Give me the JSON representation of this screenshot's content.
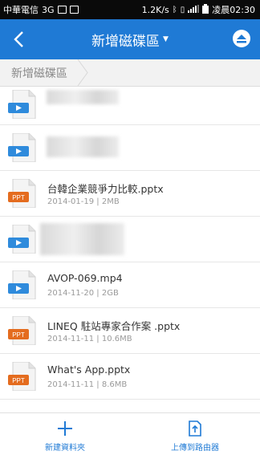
{
  "status_bar": {
    "carrier": "中華電信",
    "network": "3G",
    "speed": "1.2K/s",
    "time": "凌晨02:30"
  },
  "app_bar": {
    "title": "新增磁碟區",
    "back_icon": "back-arrow-icon",
    "eject_icon": "eject-icon",
    "accent_color": "#1f7ad5"
  },
  "breadcrumb": {
    "items": [
      "新增磁碟區"
    ]
  },
  "files": [
    {
      "type": "video",
      "name": "",
      "meta": "",
      "redacted": true
    },
    {
      "type": "video",
      "name": "",
      "meta": "",
      "redacted": true
    },
    {
      "type": "ppt",
      "badge": "PPT",
      "name": "台韓企業競爭力比較.pptx",
      "meta": "2014-01-19 | 2MB"
    },
    {
      "type": "video",
      "name": "",
      "meta": "",
      "redacted": true
    },
    {
      "type": "video",
      "name": "AVOP-069.mp4",
      "meta": "2014-11-20 | 2GB"
    },
    {
      "type": "ppt",
      "badge": "PPT",
      "name": "LINEQ  駐站專家合作案 .pptx",
      "meta": "2014-11-11 | 10.6MB"
    },
    {
      "type": "ppt",
      "badge": "PPT",
      "name": "What's App.pptx",
      "meta": "2014-11-11 | 8.6MB"
    }
  ],
  "bottom_bar": {
    "new_folder_label": "新建資料夾",
    "upload_label": "上傳到路由器"
  }
}
